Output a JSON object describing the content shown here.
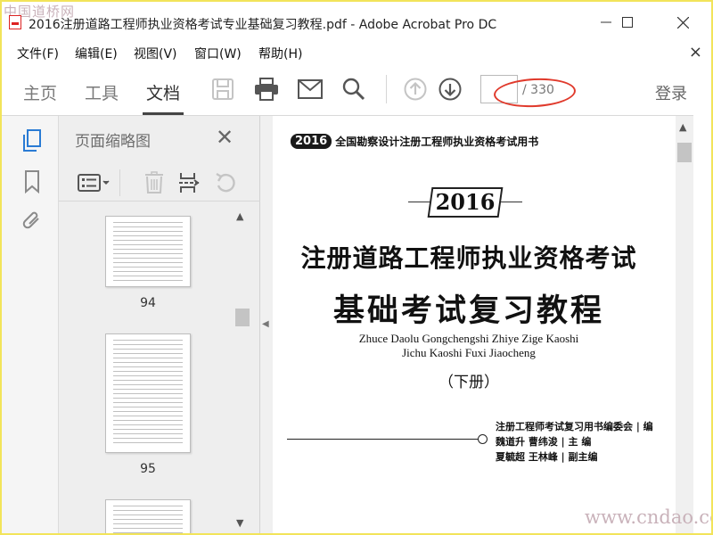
{
  "window": {
    "title": "2016注册道路工程师执业资格考试专业基础复习教程.pdf - Adobe Acrobat Pro DC",
    "watermark_top": "中国道桥网",
    "watermark_bottom": "www.cndao.com"
  },
  "menu": [
    "文件(F)",
    "编辑(E)",
    "视图(V)",
    "窗口(W)",
    "帮助(H)"
  ],
  "toolbar": {
    "tabs": [
      "主页",
      "工具",
      "文档"
    ],
    "active_tab": "文档",
    "page_current": "",
    "page_total": "/ 330",
    "login": "登录"
  },
  "thumbnails_panel": {
    "title": "页面缩略图",
    "pages": [
      {
        "label": "94"
      },
      {
        "label": "95"
      },
      {
        "label": ""
      }
    ]
  },
  "document": {
    "header_badge": "2016",
    "header_text": "全国勘察设计注册工程师执业资格考试用书",
    "year": "2016",
    "title_line1": "注册道路工程师执业资格考试",
    "title_line2": "基础考试复习教程",
    "pinyin_line1": "Zhuce Daolu Gongchengshi Zhiye Zige Kaoshi",
    "pinyin_line2": "Jichu Kaoshi Fuxi Jiaocheng",
    "volume": "（下册）",
    "editor_line1": "注册工程师考试复习用书编委会 | 编",
    "editor_line2": "魏道升  曹纬浚 | 主  编",
    "editor_line3": "夏毓超  王林峰 | 副主编"
  },
  "colors": {
    "accent_blue": "#2a7bd4",
    "annotation_red": "#e03a2c",
    "frame_yellow": "#f2e45a"
  }
}
